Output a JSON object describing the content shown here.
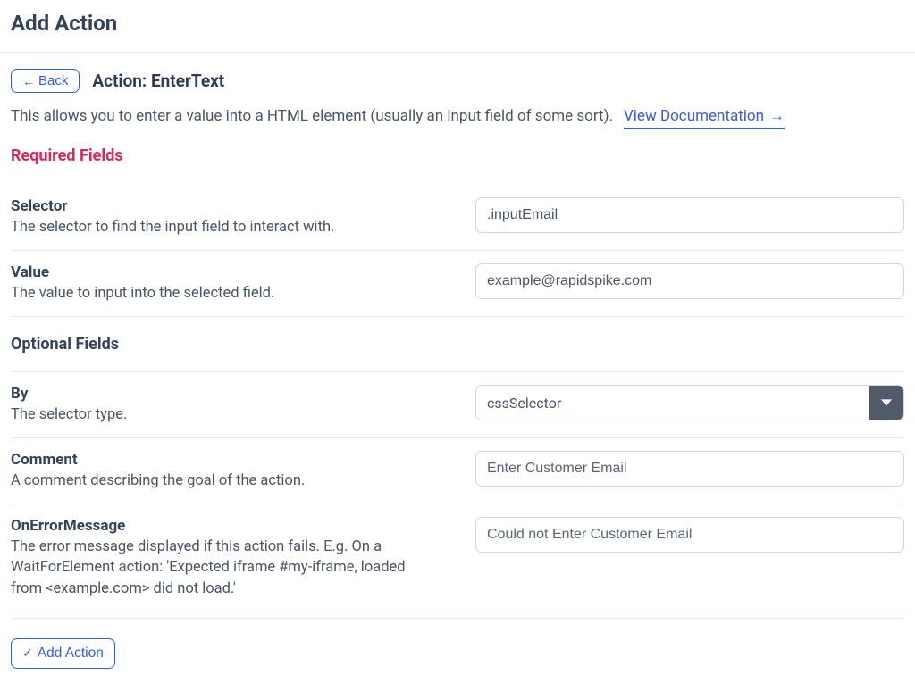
{
  "page_title": "Add Action",
  "back_label": "Back",
  "action_header_prefix": "Action: ",
  "action_name": "EnterText",
  "description": "This allows you to enter a value into a HTML element (usually an input field of some sort).",
  "doc_link_label": "View Documentation",
  "sections": {
    "required_title": "Required Fields",
    "optional_title": "Optional Fields"
  },
  "fields": {
    "selector": {
      "label": "Selector",
      "help": "The selector to find the input field to interact with.",
      "value": ".inputEmail"
    },
    "value": {
      "label": "Value",
      "help": "The value to input into the selected field.",
      "value": "example@rapidspike.com"
    },
    "by": {
      "label": "By",
      "help": "The selector type.",
      "value": "cssSelector"
    },
    "comment": {
      "label": "Comment",
      "help": "A comment describing the goal of the action.",
      "placeholder": "Enter Customer Email",
      "value": ""
    },
    "onerror": {
      "label": "OnErrorMessage",
      "help": "The error message displayed if this action fails. E.g. On a WaitForElement action: 'Expected iframe #my-iframe, loaded from <example.com> did not load.'",
      "placeholder": "Could not Enter Customer Email",
      "value": ""
    }
  },
  "submit_label": "Add Action"
}
